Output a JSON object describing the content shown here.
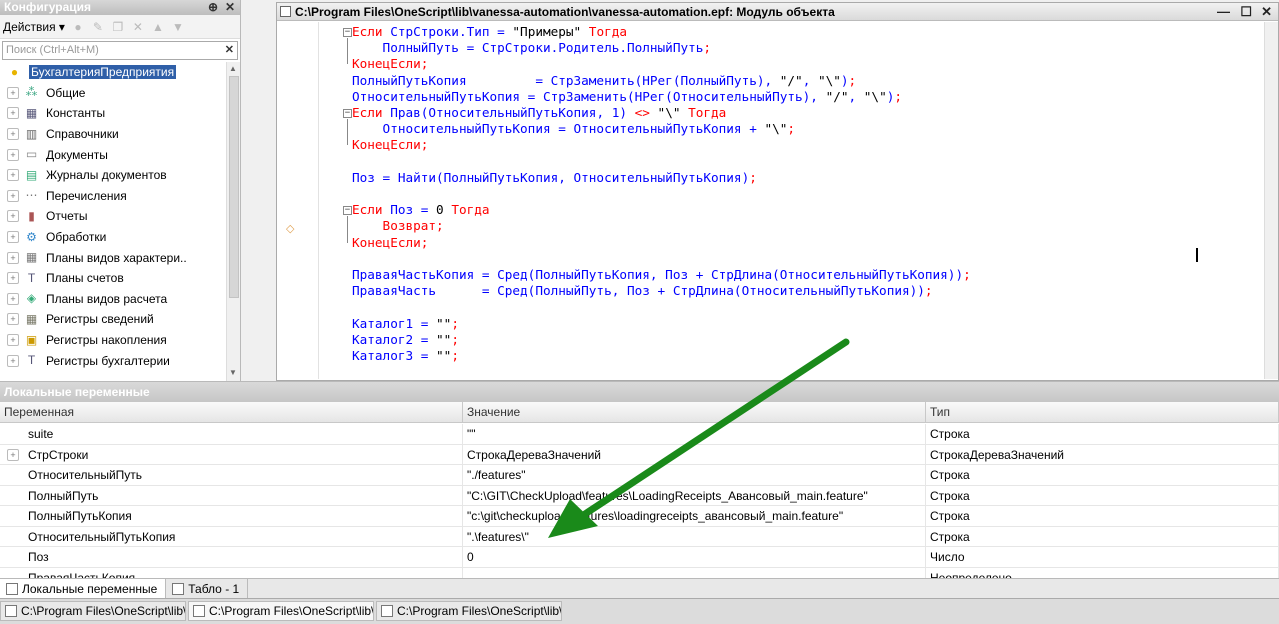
{
  "config_panel": {
    "title": "Конфигурация",
    "actions_label": "Действия",
    "search_placeholder": "Поиск (Ctrl+Alt+M)",
    "items": [
      {
        "label": "БухгалтерияПредприятия",
        "icon": "config-root-icon",
        "selected": true
      },
      {
        "label": "Общие",
        "icon": "common-icon"
      },
      {
        "label": "Константы",
        "icon": "constants-icon"
      },
      {
        "label": "Справочники",
        "icon": "catalogs-icon"
      },
      {
        "label": "Документы",
        "icon": "documents-icon"
      },
      {
        "label": "Журналы документов",
        "icon": "journals-icon"
      },
      {
        "label": "Перечисления",
        "icon": "enums-icon"
      },
      {
        "label": "Отчеты",
        "icon": "reports-icon"
      },
      {
        "label": "Обработки",
        "icon": "dataprocessors-icon"
      },
      {
        "label": "Планы видов характери..",
        "icon": "chart-char-icon"
      },
      {
        "label": "Планы счетов",
        "icon": "chart-accounts-icon"
      },
      {
        "label": "Планы видов расчета",
        "icon": "chart-calc-icon"
      },
      {
        "label": "Регистры сведений",
        "icon": "info-registers-icon"
      },
      {
        "label": "Регистры накопления",
        "icon": "accum-registers-icon"
      },
      {
        "label": "Регистры бухгалтерии",
        "icon": "account-registers-icon"
      }
    ]
  },
  "editor": {
    "title": "C:\\Program Files\\OneScript\\lib\\vanessa-automation\\vanessa-automation.epf: Модуль объекта",
    "lines": [
      [
        [
          "kw",
          "Если "
        ],
        [
          "id",
          "СтрСтроки.Тип = "
        ],
        [
          "st",
          "\"Примеры\""
        ],
        [
          "kw",
          " Тогда"
        ]
      ],
      [
        [
          "id",
          "    ПолныйПуть = СтрСтроки.Родитель.ПолныйПуть"
        ],
        [
          "op",
          ";"
        ]
      ],
      [
        [
          "kw",
          "КонецЕсли"
        ],
        [
          "op",
          ";"
        ]
      ],
      [
        [
          "id",
          "ПолныйПутьКопия         = СтрЗаменить(НРег(ПолныйПуть), "
        ],
        [
          "st",
          "\"/\""
        ],
        [
          "id",
          ", "
        ],
        [
          "st",
          "\"\\\""
        ],
        [
          "id",
          ")"
        ],
        [
          "op",
          ";"
        ]
      ],
      [
        [
          "id",
          "ОтносительныйПутьКопия = СтрЗаменить(НРег(ОтносительныйПуть), "
        ],
        [
          "st",
          "\"/\""
        ],
        [
          "id",
          ", "
        ],
        [
          "st",
          "\"\\\""
        ],
        [
          "id",
          ")"
        ],
        [
          "op",
          ";"
        ]
      ],
      [
        [
          "kw",
          "Если "
        ],
        [
          "id",
          "Прав(ОтносительныйПутьКопия, 1) "
        ],
        [
          "op",
          "<>"
        ],
        [
          "st",
          " \"\\\""
        ],
        [
          "kw",
          " Тогда"
        ]
      ],
      [
        [
          "id",
          "    ОтносительныйПутьКопия = ОтносительныйПутьКопия + "
        ],
        [
          "st",
          "\"\\\""
        ],
        [
          "op",
          ";"
        ]
      ],
      [
        [
          "kw",
          "КонецЕсли"
        ],
        [
          "op",
          ";"
        ]
      ],
      [],
      [
        [
          "id",
          "Поз = Найти(ПолныйПутьКопия, ОтносительныйПутьКопия)"
        ],
        [
          "op",
          ";"
        ]
      ],
      [],
      [
        [
          "kw",
          "Если "
        ],
        [
          "id",
          "Поз = "
        ],
        [
          "st",
          "0"
        ],
        [
          "kw",
          " Тогда"
        ]
      ],
      [
        [
          "kw",
          "    Возврат"
        ],
        [
          "op",
          ";"
        ]
      ],
      [
        [
          "kw",
          "КонецЕсли"
        ],
        [
          "op",
          ";"
        ]
      ],
      [],
      [
        [
          "id",
          "ПраваяЧастьКопия = Сред(ПолныйПутьКопия, Поз + СтрДлина(ОтносительныйПутьКопия))"
        ],
        [
          "op",
          ";"
        ]
      ],
      [
        [
          "id",
          "ПраваяЧасть      = Сред(ПолныйПуть, Поз + СтрДлина(ОтносительныйПутьКопия))"
        ],
        [
          "op",
          ";"
        ]
      ],
      [],
      [
        [
          "id",
          "Каталог1 = "
        ],
        [
          "st",
          "\"\""
        ],
        [
          "op",
          ";"
        ]
      ],
      [
        [
          "id",
          "Каталог2 = "
        ],
        [
          "st",
          "\"\""
        ],
        [
          "op",
          ";"
        ]
      ],
      [
        [
          "id",
          "Каталог3 = "
        ],
        [
          "st",
          "\"\""
        ],
        [
          "op",
          ";"
        ]
      ]
    ]
  },
  "locals": {
    "title": "Локальные переменные",
    "columns": [
      "Переменная",
      "Значение",
      "Тип"
    ],
    "rows": [
      {
        "name": "suite",
        "value": "\"\"",
        "type": "Строка",
        "expandable": false
      },
      {
        "name": "СтрСтроки",
        "value": "СтрокаДереваЗначений",
        "type": "СтрокаДереваЗначений",
        "expandable": true
      },
      {
        "name": "ОтносительныйПуть",
        "value": "\"./features\"",
        "type": "Строка",
        "expandable": false
      },
      {
        "name": "ПолныйПуть",
        "value": "\"C:\\GIT\\CheckUpload\\features\\LoadingReceipts_Авансовый_main.feature\"",
        "type": "Строка",
        "expandable": false
      },
      {
        "name": "ПолныйПутьКопия",
        "value": "\"c:\\git\\checkupload\\features\\loadingreceipts_авансовый_main.feature\"",
        "type": "Строка",
        "expandable": false
      },
      {
        "name": "ОтносительныйПутьКопия",
        "value": "\".\\features\\\"",
        "type": "Строка",
        "expandable": false
      },
      {
        "name": "Поз",
        "value": "0",
        "type": "Число",
        "expandable": false
      },
      {
        "name": "ПраваяЧастьКопия",
        "value": "",
        "type": "Неопределено",
        "expandable": false
      }
    ]
  },
  "bottom_tabs": [
    {
      "label": "Локальные переменные",
      "active": true
    },
    {
      "label": "Табло - 1",
      "active": false
    }
  ],
  "taskbar": [
    {
      "label": "C:\\Program Files\\OneScript\\lib\\..."
    },
    {
      "label": "C:\\Program Files\\OneScript\\lib\\..."
    },
    {
      "label": "C:\\Program Files\\OneScript\\lib\\..."
    }
  ],
  "colors": {
    "keyword": "#ff0000",
    "identifier": "#0000ff",
    "selection": "#2f5fa8",
    "arrow": "#1a8a1a"
  }
}
